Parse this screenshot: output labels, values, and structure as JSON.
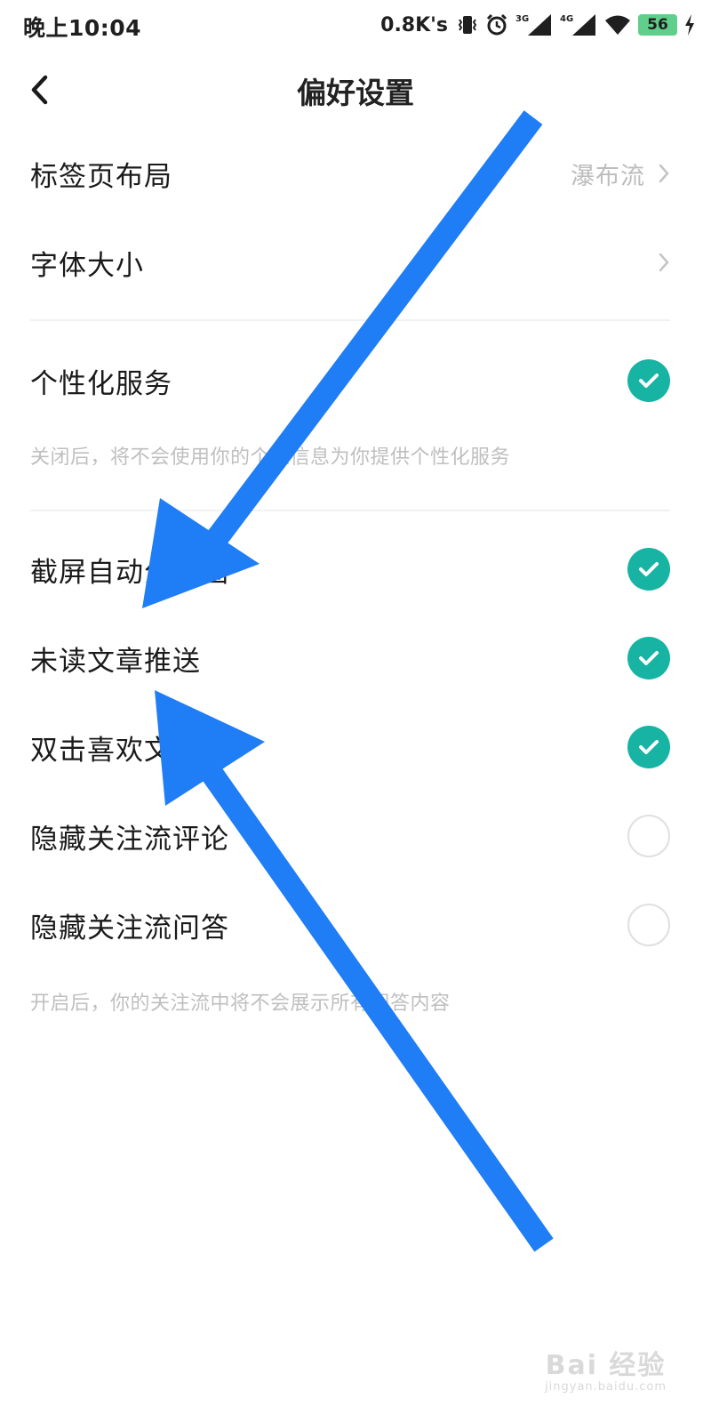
{
  "status_bar": {
    "time": "晚上10:04",
    "net_speed": "0.8K's",
    "signal_3g": "3G",
    "signal_4g": "4G",
    "battery": "56",
    "icons": [
      "vibrate-icon",
      "alarm-icon",
      "signal-3g-icon",
      "signal-4g-icon",
      "wifi-icon",
      "battery-icon",
      "charging-icon"
    ]
  },
  "nav": {
    "title": "偏好设置",
    "back_icon": "back-chevron-icon"
  },
  "settings": {
    "tab_layout": {
      "label": "标签页布局",
      "value": "瀑布流"
    },
    "font_size": {
      "label": "字体大小"
    },
    "personalized": {
      "label": "个性化服务",
      "checked": true,
      "hint": "关闭后，将不会使用你的个性信息为你提供个性化服务"
    },
    "screenshot_share": {
      "label": "截屏自动分享图",
      "checked": true
    },
    "unread_push": {
      "label": "未读文章推送",
      "checked": true
    },
    "double_tap_like": {
      "label": "双击喜欢文章",
      "checked": true
    },
    "hide_follow_comments": {
      "label": "隐藏关注流评论",
      "checked": false
    },
    "hide_follow_qa": {
      "label": "隐藏关注流问答",
      "checked": false,
      "hint": "开启后，你的关注流中将不会展示所有问答内容"
    }
  },
  "colors": {
    "accent": "#17b3a3",
    "annotation_arrow": "#1f7df5",
    "battery": "#5fcf8b"
  },
  "watermark": {
    "main": "Bai 经验",
    "sub": "jingyan.baidu.com"
  }
}
